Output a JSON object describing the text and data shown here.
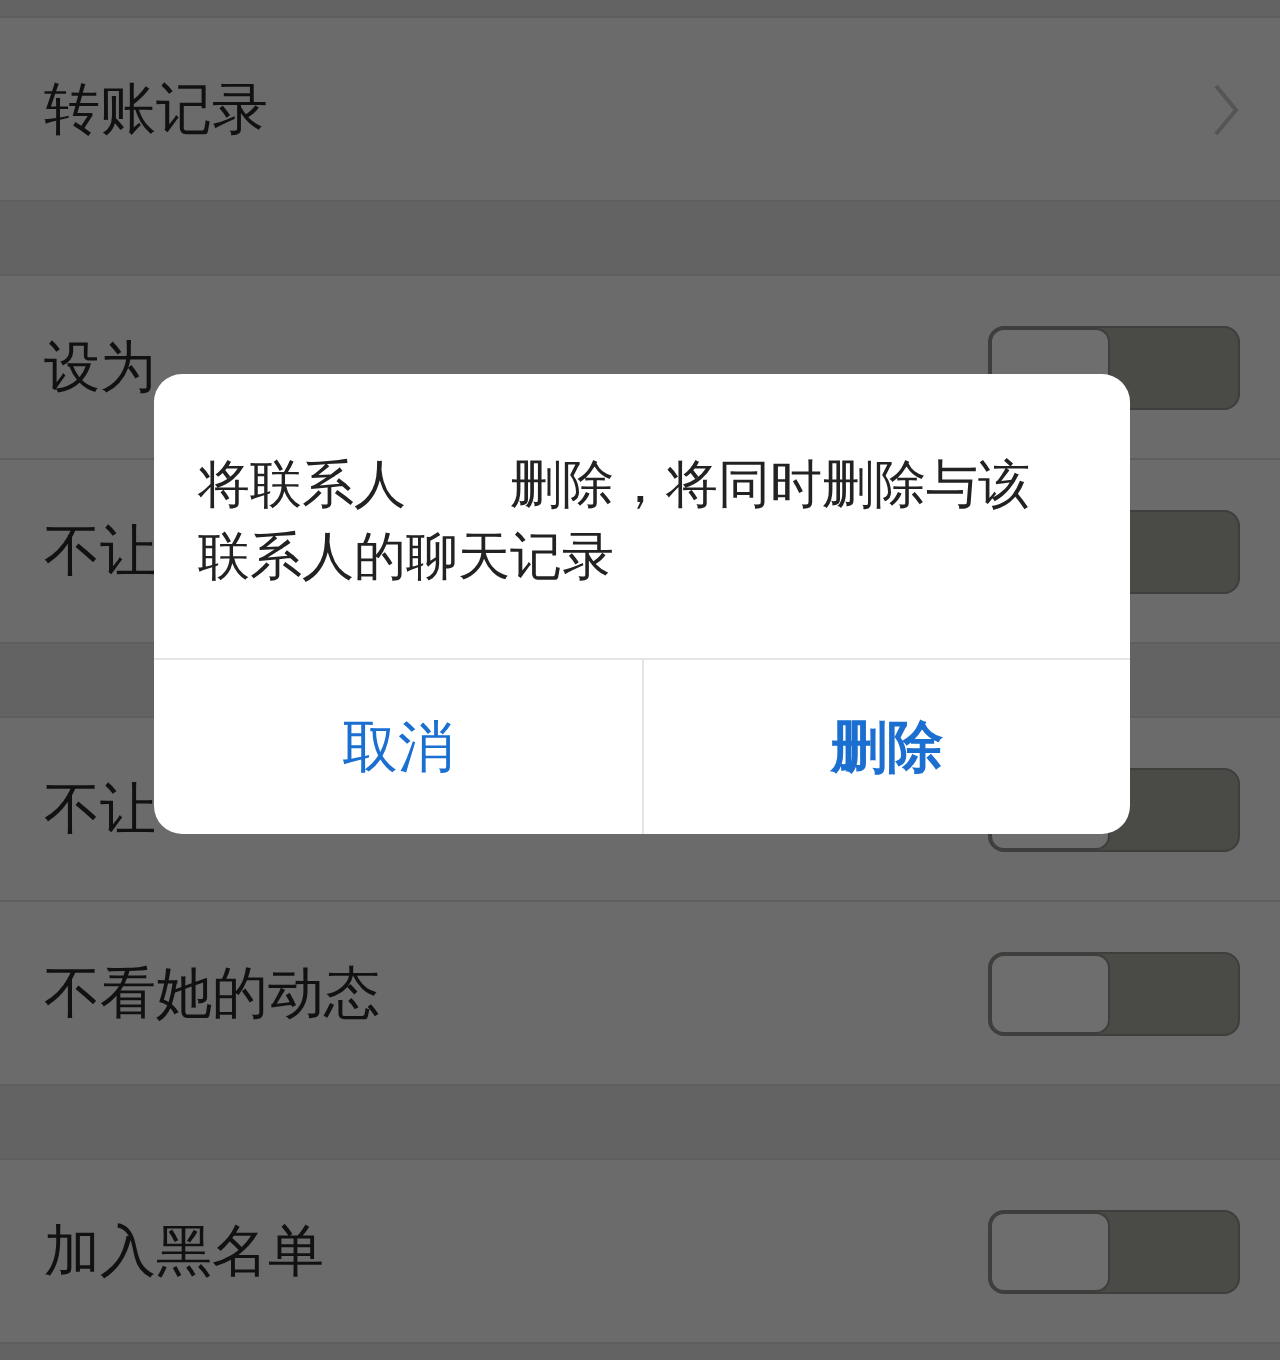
{
  "sections": [
    {
      "rows": [
        {
          "kind": "link",
          "label": "转账记录"
        }
      ]
    },
    {
      "rows": [
        {
          "kind": "toggle",
          "label": "设为",
          "on": false
        },
        {
          "kind": "toggle",
          "label": "不让",
          "on": false
        }
      ]
    },
    {
      "rows": [
        {
          "kind": "toggle",
          "label": "不让",
          "on": false
        },
        {
          "kind": "toggle",
          "label": "不看她的动态",
          "on": false
        }
      ]
    },
    {
      "rows": [
        {
          "kind": "toggle",
          "label": "加入黑名单",
          "on": false
        }
      ]
    }
  ],
  "dialog": {
    "message": "将联系人　　删除，将同时删除与该联系人的聊天记录",
    "buttons": [
      {
        "label": "取消",
        "primary": false
      },
      {
        "label": "删除",
        "primary": true
      }
    ]
  }
}
